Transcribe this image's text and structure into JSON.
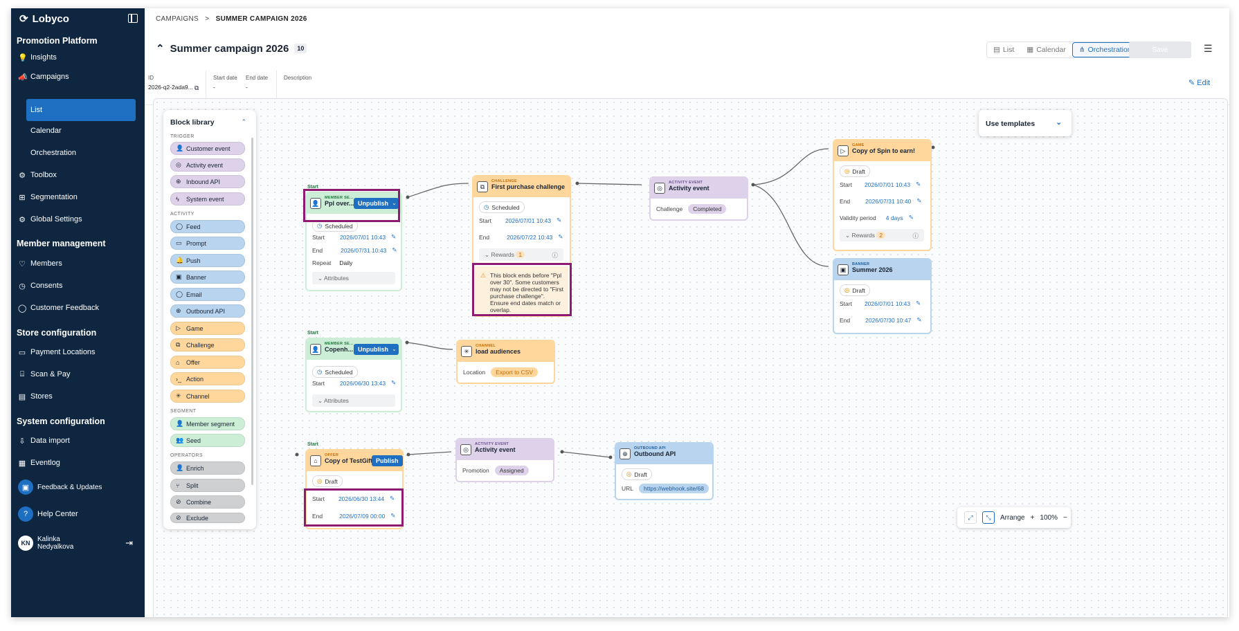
{
  "app": {
    "brand": "Lobyco"
  },
  "sidebar": {
    "groups": {
      "promotion": "Promotion Platform",
      "member": "Member management",
      "store": "Store configuration",
      "system": "System configuration"
    },
    "items": {
      "insights": "Insights",
      "campaigns": "Campaigns",
      "list": "List",
      "calendar": "Calendar",
      "orchestration": "Orchestration",
      "toolbox": "Toolbox",
      "segmentation": "Segmentation",
      "global_settings": "Global Settings",
      "members": "Members",
      "consents": "Consents",
      "customer_feedback": "Customer Feedback",
      "payment_locations": "Payment Locations",
      "scan_pay": "Scan & Pay",
      "stores": "Stores",
      "data_import": "Data import",
      "eventlog": "Eventlog",
      "feedback_updates": "Feedback & Updates",
      "help_center": "Help Center"
    },
    "user": {
      "initials": "KN",
      "first": "Kalinka",
      "last": "Nedyalkova"
    }
  },
  "header": {
    "breadcrumb_root": "CAMPAIGNS",
    "breadcrumb_sep": ">",
    "breadcrumb_current": "SUMMER CAMPAIGN 2026",
    "title": "Summer campaign 2026",
    "count": "10",
    "views": {
      "list": "List",
      "calendar": "Calendar",
      "orchestration": "Orchestration"
    },
    "save": "Save",
    "edit": "Edit",
    "meta": {
      "id_label": "ID",
      "id_value": "2026-q2-2ada9...",
      "start_label": "Start date",
      "start_value": "-",
      "end_label": "End date",
      "end_value": "-",
      "desc_label": "Description"
    }
  },
  "library": {
    "title": "Block library",
    "cat_trigger": "TRIGGER",
    "cat_activity": "ACTIVITY",
    "cat_segment": "SEGMENT",
    "cat_operators": "OPERATORS",
    "trigger": [
      "Customer event",
      "Activity event",
      "Inbound API",
      "System event"
    ],
    "activity": [
      "Feed",
      "Prompt",
      "Push",
      "Banner",
      "Email",
      "Outbound API",
      "Game",
      "Challenge",
      "Offer",
      "Action",
      "Channel"
    ],
    "segment": [
      "Member segment",
      "Seed"
    ],
    "operators": [
      "Enrich",
      "Split",
      "Combine",
      "Exclude"
    ]
  },
  "templates": {
    "label": "Use templates"
  },
  "nodes": {
    "n1": {
      "start": "Start",
      "kind": "MEMBER SE...",
      "title": "Ppl over...",
      "action": "Unpublish",
      "status": "Scheduled",
      "start_label": "Start",
      "start_value": "2026/07/01 10:43",
      "end_label": "End",
      "end_value": "2026/07/31 10:43",
      "repeat_label": "Repeat",
      "repeat_value": "Daily",
      "attributes": "Attributes"
    },
    "n2": {
      "kind": "CHALLENGE",
      "title": "First purchase challenge",
      "status": "Scheduled",
      "start_label": "Start",
      "start_value": "2026/07/01 10:43",
      "end_label": "End",
      "end_value": "2026/07/22 10:43",
      "rewards": "Rewards",
      "rewards_count": "1",
      "warning": "This block ends before \"Ppl over 30\". Some customers may not be directed to \"First purchase challenge\". Ensure end dates match or overlap."
    },
    "n3": {
      "kind": "ACTIVITY EVENT",
      "title": "Activity event",
      "label": "Challenge",
      "value": "Completed"
    },
    "n4": {
      "kind": "GAME",
      "title": "Copy of Spin to earn!",
      "status": "Draft",
      "start_label": "Start",
      "start_value": "2026/07/01 10:43",
      "end_label": "End",
      "end_value": "2026/07/31 10:40",
      "validity_label": "Validity period",
      "validity_value": "4 days",
      "rewards": "Rewards",
      "rewards_count": "2"
    },
    "n5": {
      "kind": "BANNER",
      "title": "Summer 2026",
      "status": "Draft",
      "start_label": "Start",
      "start_value": "2026/07/01 10:43",
      "end_label": "End",
      "end_value": "2026/07/30 10:47"
    },
    "n6": {
      "start": "Start",
      "kind": "MEMBER SE...",
      "title": "Copenh...",
      "action": "Unpublish",
      "status": "Scheduled",
      "start_label": "Start",
      "start_value": "2026/06/30 13:43",
      "attributes": "Attributes"
    },
    "n7": {
      "kind": "CHANNEL",
      "title": "load audiences",
      "label": "Location",
      "value": "Export to CSV"
    },
    "n8": {
      "start": "Start",
      "kind": "OFFER",
      "title": "Copy of TestGift",
      "action": "Publish",
      "status": "Draft",
      "start_label": "Start",
      "start_value": "2026/06/30 13:44",
      "end_label": "End",
      "end_value": "2026/07/09 00:00"
    },
    "n9": {
      "kind": "ACTIVITY EVENT",
      "title": "Activity event",
      "label": "Promotion",
      "value": "Assigned"
    },
    "n10": {
      "kind": "OUTBOUND API",
      "title": "Outbound API",
      "status": "Draft",
      "label": "URL",
      "value": "https://webhook.site/68"
    }
  },
  "zoom": {
    "arrange": "Arrange",
    "plus": "+",
    "level": "100%",
    "minus": "−"
  },
  "colors": {
    "sidebar": "#0f2640",
    "accent": "#1e6fc2",
    "highlight": "#8e1a72",
    "warning_bg": "#fdf1dd"
  }
}
